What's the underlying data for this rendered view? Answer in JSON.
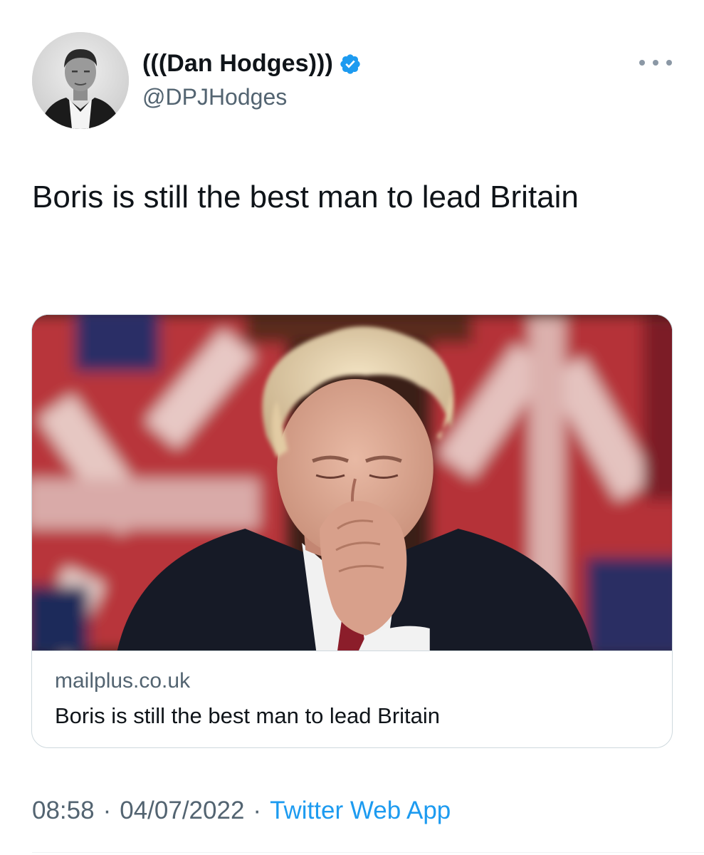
{
  "tweet": {
    "author": {
      "display_name": "(((Dan Hodges)))",
      "handle": "@DPJHodges",
      "verified": true,
      "avatar_icon": "profile-photo"
    },
    "menu_icon": "more-horizontal-icon",
    "text": "Boris is still the best man to lead Britain",
    "link_card": {
      "image_icon": "article-photo",
      "domain": "mailplus.co.uk",
      "title": "Boris is still the best man to lead Britain"
    },
    "meta": {
      "time": "08:58",
      "separator": "·",
      "date": "04/07/2022",
      "source": "Twitter Web App"
    }
  },
  "colors": {
    "text_primary": "#0f1419",
    "text_secondary": "#536471",
    "accent": "#1d9bf0",
    "border": "#cfd9de"
  }
}
